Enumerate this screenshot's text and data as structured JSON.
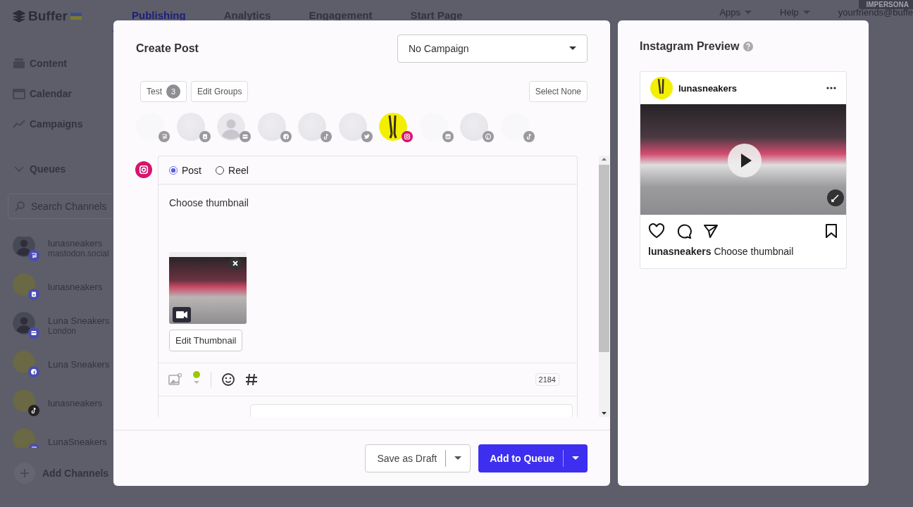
{
  "top_nav": {
    "logo": "Buffer",
    "tabs": [
      {
        "label": "Publishing",
        "selected": true
      },
      {
        "label": "Analytics",
        "selected": false
      },
      {
        "label": "Engagement",
        "selected": false
      },
      {
        "label": "Start Page",
        "selected": false
      }
    ],
    "apps": "Apps",
    "help": "Help",
    "account": "yourfriends@buffe",
    "badge": "IMPERSONA"
  },
  "sidebar": {
    "items": [
      {
        "label": "Content",
        "kind": "tray"
      },
      {
        "label": "Calendar",
        "kind": "calendar"
      },
      {
        "label": "Campaigns",
        "kind": "trend"
      }
    ],
    "queues": "Queues",
    "search": {
      "placeholder": "Search Channels"
    },
    "channels": [
      {
        "name": "lunasneakers",
        "detail": "mastodon.social",
        "has_photo": false,
        "kind": "mastodon"
      },
      {
        "name": "lunasneakers",
        "has_photo": true,
        "kind": "startpage"
      },
      {
        "name": "Luna Sneakers",
        "detail": "London",
        "has_photo": false,
        "kind": "gbp"
      },
      {
        "name": "Luna Sneakers",
        "has_photo": true,
        "kind": "facebook"
      },
      {
        "name": "lunasneakers",
        "has_photo": true,
        "kind": "tiktok"
      },
      {
        "name": "LunaSneakers",
        "has_photo": true,
        "kind": "mastodon"
      }
    ],
    "add_channels": "Add Channels"
  },
  "create_post": {
    "title": "Create Post",
    "campaign": "No Campaign",
    "group": {
      "label": "Test",
      "count": "3"
    },
    "edit_groups": "Edit Groups",
    "select_none": "Select None",
    "channels": [
      {
        "has_avatar": false,
        "kind": "mastodon",
        "selected": false
      },
      {
        "has_avatar": true,
        "has_photo": true,
        "kind": "startpage",
        "selected": false
      },
      {
        "has_avatar": true,
        "has_photo": false,
        "kind": "gbp",
        "selected": false
      },
      {
        "has_avatar": true,
        "has_photo": true,
        "kind": "facebook",
        "selected": false
      },
      {
        "has_avatar": true,
        "has_photo": true,
        "kind": "tiktok",
        "selected": false
      },
      {
        "has_avatar": true,
        "has_photo": true,
        "kind": "twitter",
        "selected": false
      },
      {
        "kind": "instagram",
        "selected": true
      },
      {
        "has_avatar": false,
        "kind": "linkedin",
        "selected": false
      },
      {
        "has_avatar": true,
        "has_photo": true,
        "kind": "pinterest",
        "selected": false
      },
      {
        "has_avatar": false,
        "kind": "tiktok",
        "selected": false
      }
    ],
    "composer": {
      "kind": "instagram",
      "post_types": [
        {
          "label": "Post",
          "selected": true
        },
        {
          "label": "Reel",
          "selected": false
        }
      ],
      "text": "Choose thumbnail",
      "edit_thumbnail": "Edit Thumbnail",
      "char_count": "2184"
    },
    "save_draft": "Save as Draft",
    "add_to_queue": "Add to Queue"
  },
  "preview": {
    "title": "Instagram Preview",
    "username": "lunasneakers",
    "caption_user": "lunasneakers",
    "caption": "Choose thumbnail"
  }
}
